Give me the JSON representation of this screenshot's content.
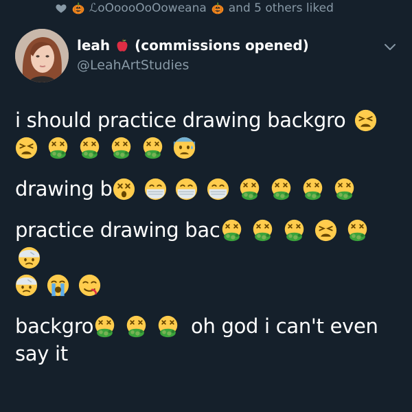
{
  "social_context": {
    "liker_name": "ℒoOoooOoOoweana",
    "suffix": "and 5 others liked"
  },
  "tweet": {
    "display_name": "leah",
    "name_suffix": "(commissions opened)",
    "handle": "@LeahArtStudies",
    "paragraphs": [
      "i should practice drawing backgro",
      "drawing b",
      "practice drawing bac",
      "backgro",
      "oh god i can't even say it"
    ]
  },
  "icons": {
    "like": "heart-icon",
    "pumpkin": "pumpkin-icon",
    "apple": "red-apple-icon",
    "caret": "chevron-down-icon",
    "emoji_set": [
      "tired-face-emoji",
      "vomiting-face-emoji",
      "anxious-sweat-face-emoji",
      "dizzy-face-emoji",
      "medical-mask-face-emoji",
      "bandaged-head-face-emoji",
      "loudly-crying-face-emoji",
      "drooling-face-emoji"
    ]
  },
  "colors": {
    "background": "#15202b",
    "text": "#ffffff",
    "secondary_text": "#8899a6"
  }
}
